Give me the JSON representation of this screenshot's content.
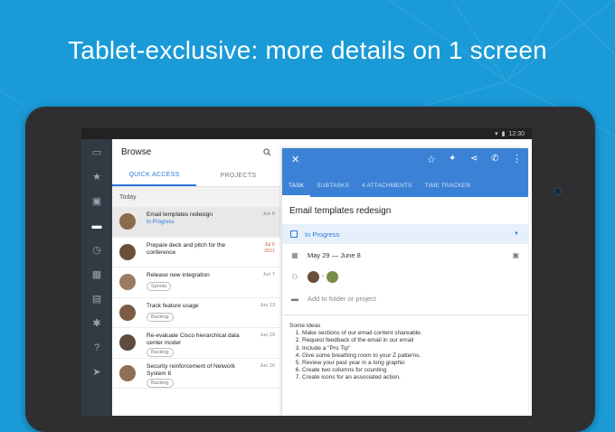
{
  "headline": "Tablet-exclusive: more details on 1 screen",
  "statusbar": {
    "time": "12:30"
  },
  "rail": {
    "icons": [
      "inbox-icon",
      "star-icon",
      "briefcase-icon",
      "folder-icon",
      "clock-icon",
      "calendar-icon",
      "grid-icon",
      "gear-icon",
      "help-icon",
      "send-icon"
    ]
  },
  "browse": {
    "title": "Browse",
    "tabs": [
      "QUICK ACCESS",
      "PROJECTS"
    ],
    "section": "Today",
    "items": [
      {
        "title": "Email templates redesign",
        "sub": "In Progress",
        "date": "Jun 8",
        "date2": "",
        "chip": "",
        "avatar": "#8a6b4a"
      },
      {
        "title": "Prepare deck and pitch for the conference",
        "sub": "",
        "date": "Jul 6",
        "date2": "2011",
        "chip": "",
        "avatar": "#6b4f3a"
      },
      {
        "title": "Release new integration",
        "sub": "",
        "date": "Jun 7",
        "date2": "",
        "chip": "Sprints",
        "avatar": "#9c7b63"
      },
      {
        "title": "Track feature usage",
        "sub": "",
        "date": "Jun 13",
        "date2": "",
        "chip": "Backlog",
        "avatar": "#7b5a46"
      },
      {
        "title": "Re-evaluate Cisco hierarchical data center model",
        "sub": "",
        "date": "Jun 29",
        "date2": "",
        "chip": "Backlog",
        "avatar": "#5f4a3e"
      },
      {
        "title": "Security reinforcement of Network System 8",
        "sub": "",
        "date": "Jun 16",
        "date2": "",
        "chip": "Backlog",
        "avatar": "#8f6f57"
      }
    ]
  },
  "detail": {
    "tabs": [
      "TASK",
      "SUBTASKS",
      "4 ATTACHMENTS",
      "TIME TRACKER"
    ],
    "title": "Email templates redesign",
    "status": "In Progress",
    "dates": "May 29 — June 8",
    "folder_placeholder": "Add to folder or project",
    "notes_heading": "Some ideas",
    "notes": [
      "Make sections of our email content shareable.",
      "Request feedback of the email in our email",
      "Include a \"Pro Tip\"",
      "Give some breathing room to your Z patterns.",
      "Review your past year in a long graphic",
      "Create two columns for counting",
      "Create icons for an associated action."
    ]
  },
  "colors": {
    "background": "#1a9ad6",
    "accent": "#3b82d6",
    "rail": "#323a44"
  }
}
